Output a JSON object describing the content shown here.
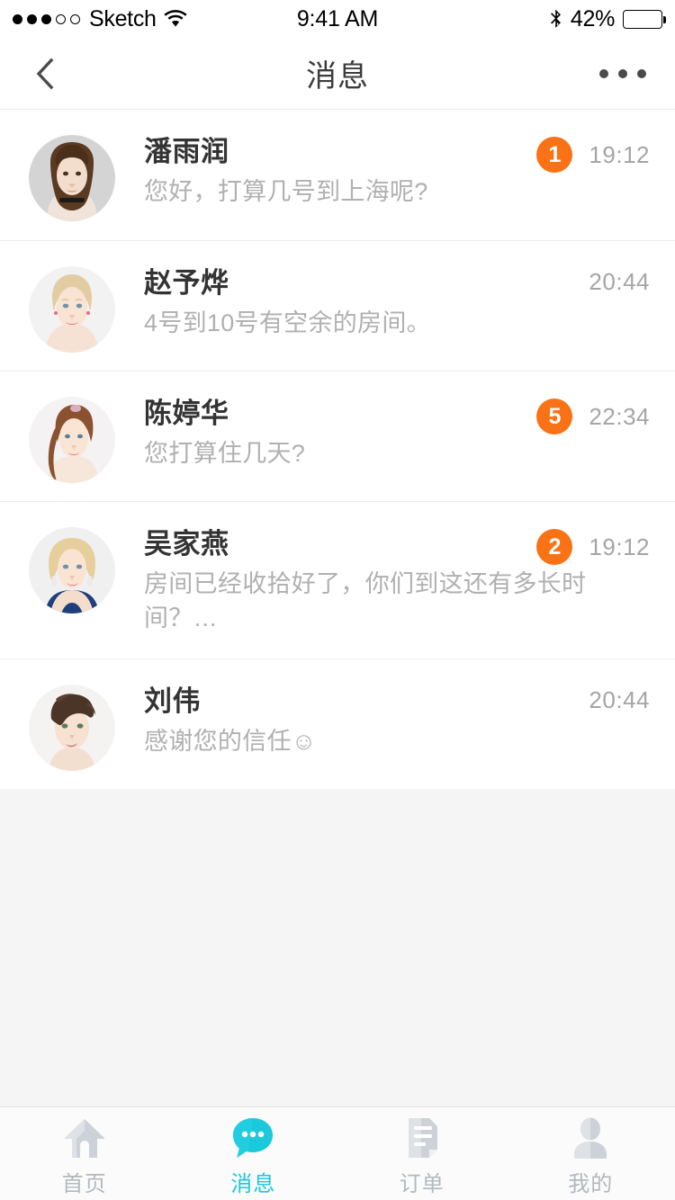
{
  "statusbar": {
    "carrier": "Sketch",
    "signal_filled": 3,
    "signal_empty": 2,
    "time": "9:41 AM",
    "battery_pct": "42%",
    "battery_level": 42,
    "wifi_icon": "wifi-icon",
    "bluetooth_icon": "bluetooth-icon",
    "battery_icon": "battery-icon"
  },
  "navbar": {
    "back_icon": "back-chevron-icon",
    "title": "消息",
    "more_icon": "more-options-icon"
  },
  "conversations": [
    {
      "name": "潘雨润",
      "message": "您好，打算几号到上海呢?",
      "time": "19:12",
      "badge": "1",
      "avatar": "avatar-pan-yurun"
    },
    {
      "name": "赵予烨",
      "message": "4号到10号有空余的房间。",
      "time": "20:44",
      "badge": "",
      "avatar": "avatar-zhao-yuye"
    },
    {
      "name": "陈婷华",
      "message": "您打算住几天?",
      "time": "22:34",
      "badge": "5",
      "avatar": "avatar-chen-tinghua"
    },
    {
      "name": "吴家燕",
      "message": "房间已经收拾好了，你们到这还有多长时间？…",
      "time": "19:12",
      "badge": "2",
      "avatar": "avatar-wu-jiayan"
    },
    {
      "name": "刘伟",
      "message": "感谢您的信任☺",
      "time": "20:44",
      "badge": "",
      "avatar": "avatar-liu-wei"
    }
  ],
  "tabbar": {
    "items": [
      {
        "label": "首页",
        "icon": "home-icon",
        "active": false
      },
      {
        "label": "消息",
        "icon": "chat-bubble-icon",
        "active": true
      },
      {
        "label": "订单",
        "icon": "document-icon",
        "active": false
      },
      {
        "label": "我的",
        "icon": "person-icon",
        "active": false
      }
    ]
  },
  "colors": {
    "accent": "#1bc8dc",
    "badge": "#f97316",
    "name_text": "#333333",
    "message_text": "#b0b0b0",
    "time_text": "#a5a5a5",
    "tab_inactive": "#b4b8bd",
    "page_background": "#f5f5f5"
  }
}
